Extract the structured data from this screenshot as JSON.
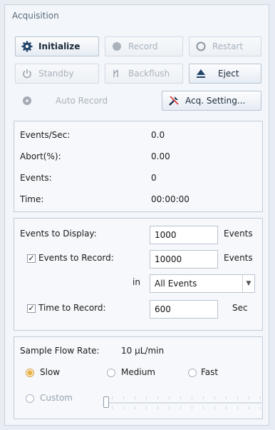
{
  "panel_title": "Acquisition",
  "buttons": {
    "initialize": "Initialize",
    "record": "Record",
    "restart": "Restart",
    "standby": "Standby",
    "backflush": "Backflush",
    "eject": "Eject",
    "auto_record": "Auto Record",
    "acq_setting": "Acq. Setting..."
  },
  "stats": {
    "events_per_sec": {
      "label": "Events/Sec:",
      "value": "0.0"
    },
    "abort": {
      "label": "Abort(%):",
      "value": "0.00"
    },
    "events": {
      "label": "Events:",
      "value": "0"
    },
    "time": {
      "label": "Time:",
      "value": "00:00:00"
    }
  },
  "display": {
    "events_to_display_label": "Events to Display:",
    "events_to_display_value": "1000",
    "events_unit": "Events",
    "events_to_record_label": "Events to Record:",
    "events_to_record_value": "10000",
    "events_to_record_unit": "Events",
    "in_label": "in",
    "in_select_value": "All Events",
    "time_to_record_label": "Time to Record:",
    "time_to_record_value": "600",
    "time_unit": "Sec"
  },
  "flow": {
    "label": "Sample Flow Rate:",
    "value": "10 µL/min",
    "slow": "Slow",
    "medium": "Medium",
    "fast": "Fast",
    "custom": "Custom",
    "selected": "slow"
  }
}
